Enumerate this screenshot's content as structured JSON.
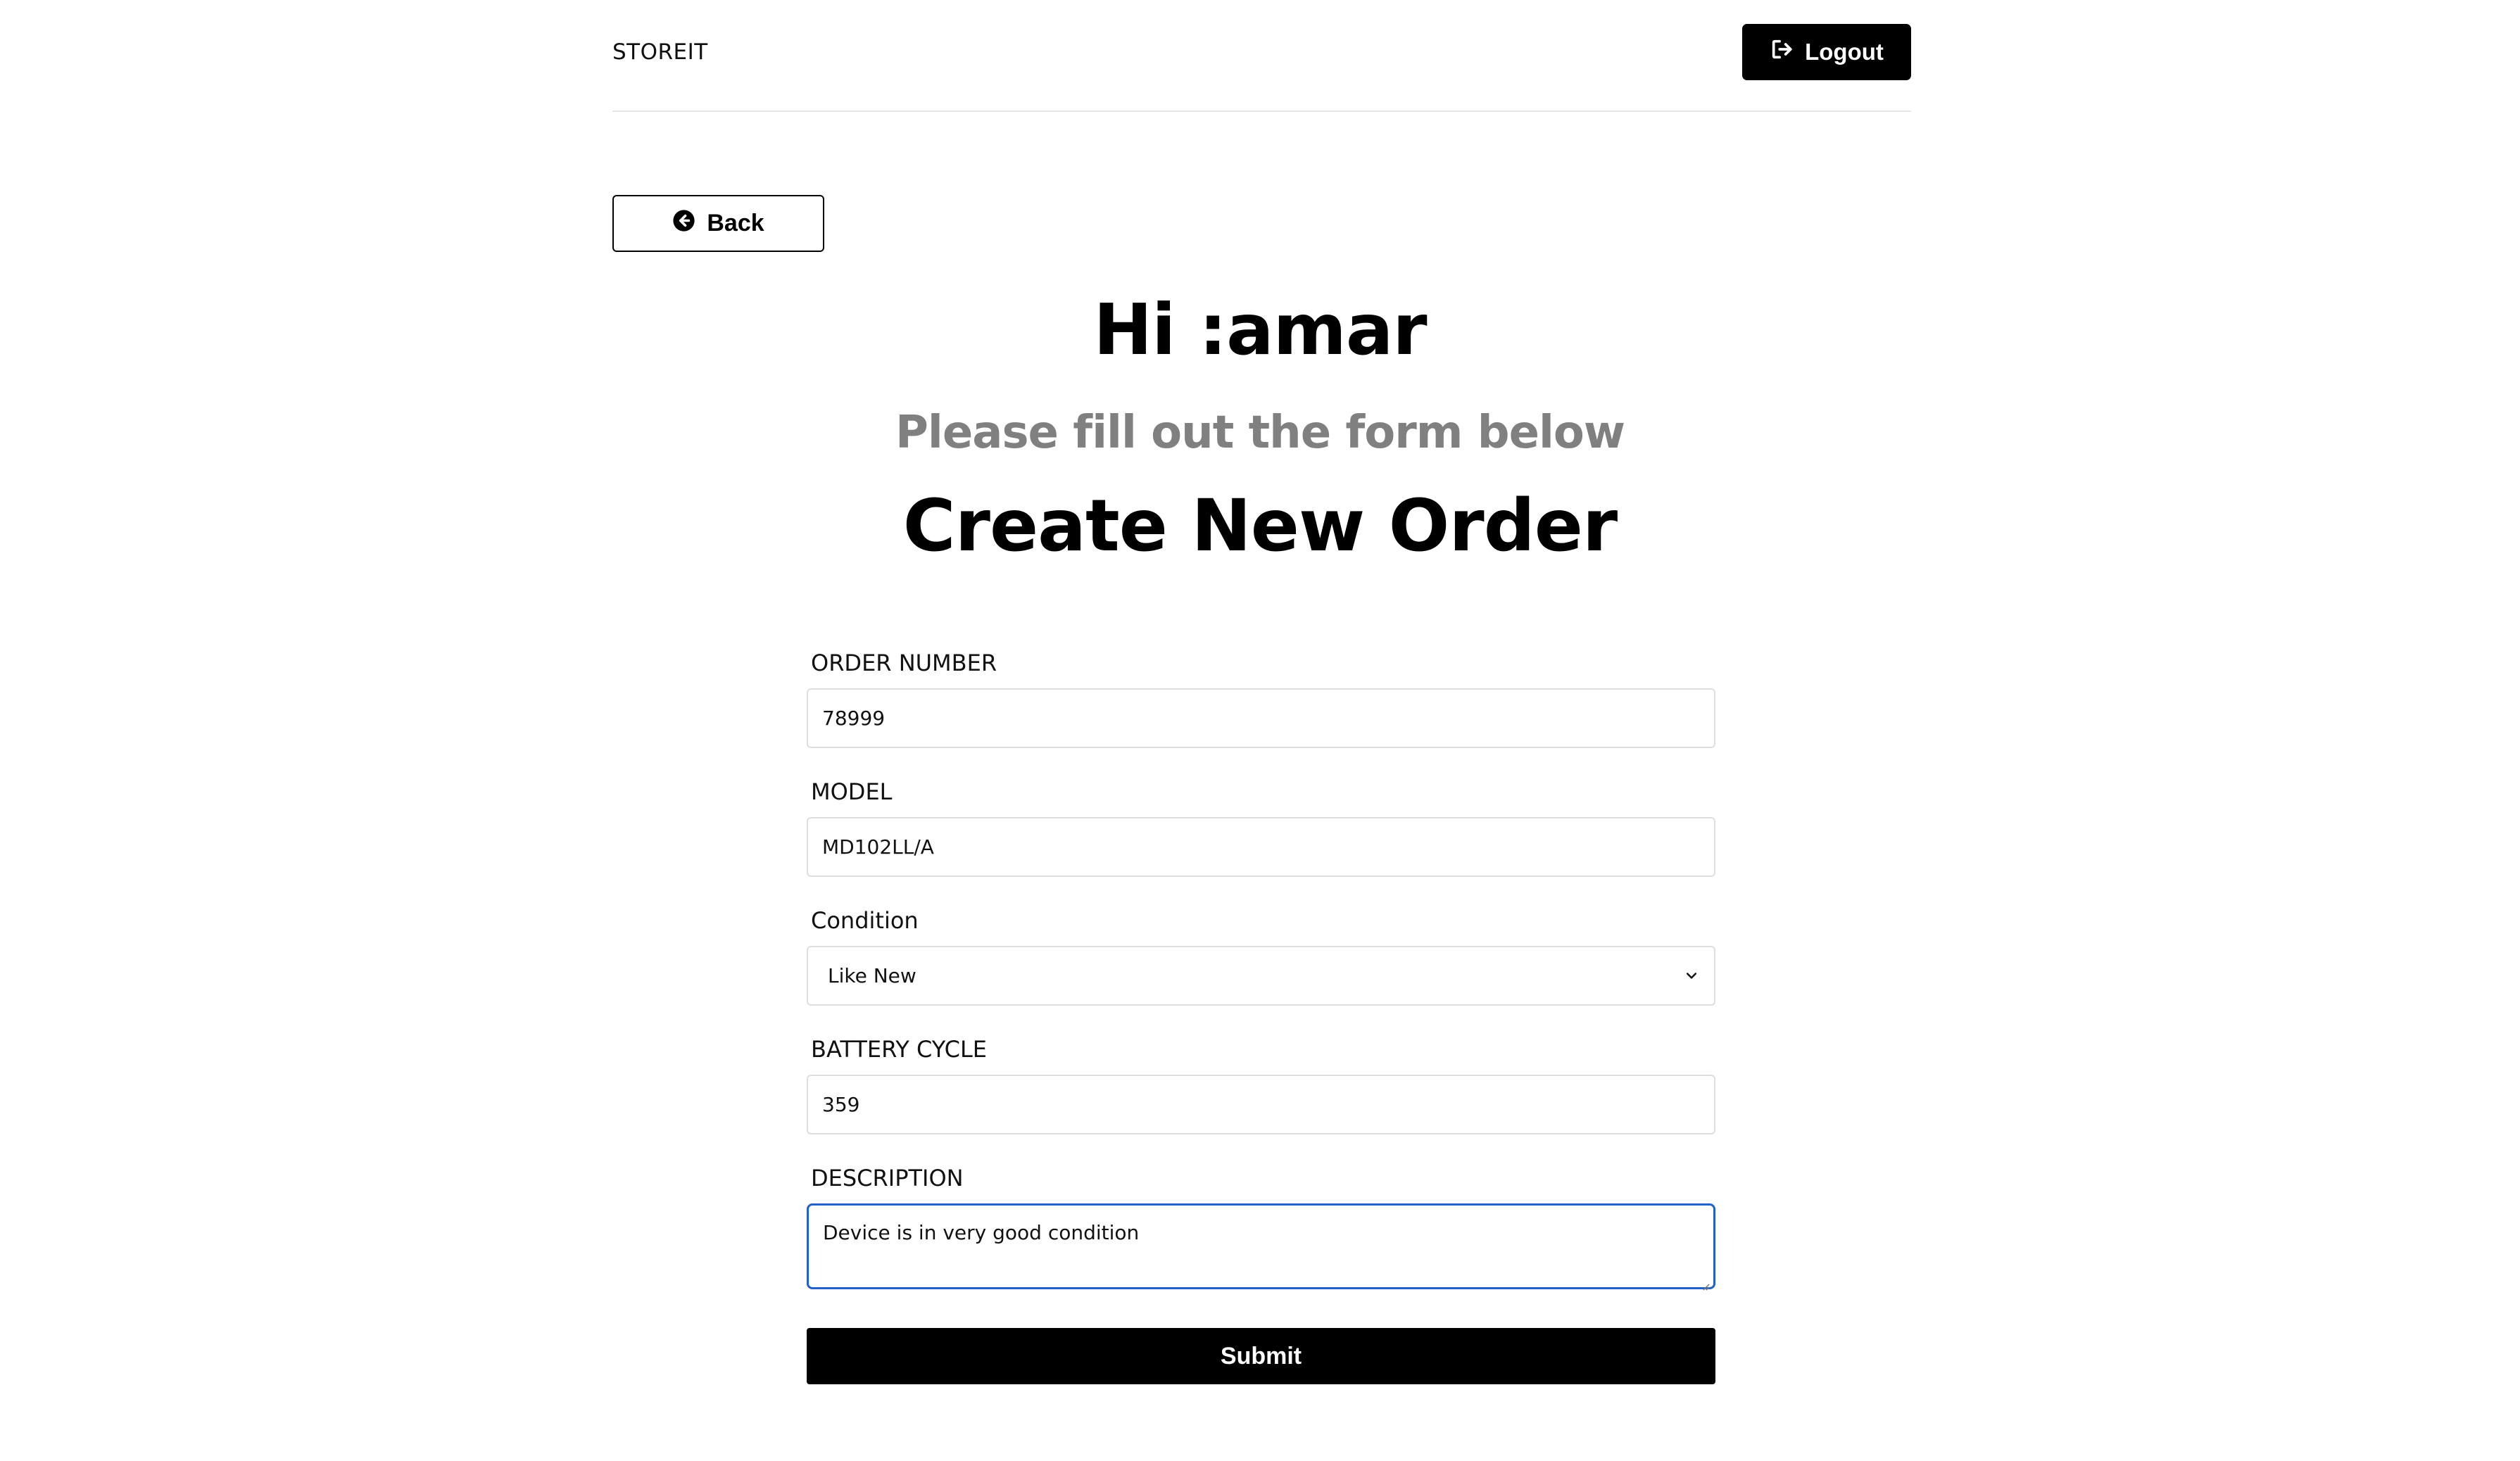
{
  "header": {
    "brand": "STOREIT",
    "logout_label": "Logout"
  },
  "nav": {
    "back_label": "Back"
  },
  "main": {
    "greeting": "Hi :amar",
    "subtitle": "Please fill out the form below",
    "title": "Create New Order"
  },
  "form": {
    "order_number": {
      "label": "ORDER NUMBER",
      "value": "78999"
    },
    "model": {
      "label": "MODEL",
      "value": "MD102LL/A"
    },
    "condition": {
      "label": "Condition",
      "value": "Like New"
    },
    "battery_cycle": {
      "label": "BATTERY CYCLE",
      "value": "359"
    },
    "description": {
      "label": "DESCRIPTION",
      "value": "Device is in very good condition"
    },
    "submit_label": "Submit"
  },
  "colors": {
    "primary": "#000000",
    "muted_heading": "#808080",
    "focus_border": "#2360c7",
    "input_border": "#dedede"
  },
  "icons": {
    "logout": "sign-out-icon",
    "back": "circle-arrow-left-icon",
    "select": "chevron-down-icon"
  }
}
